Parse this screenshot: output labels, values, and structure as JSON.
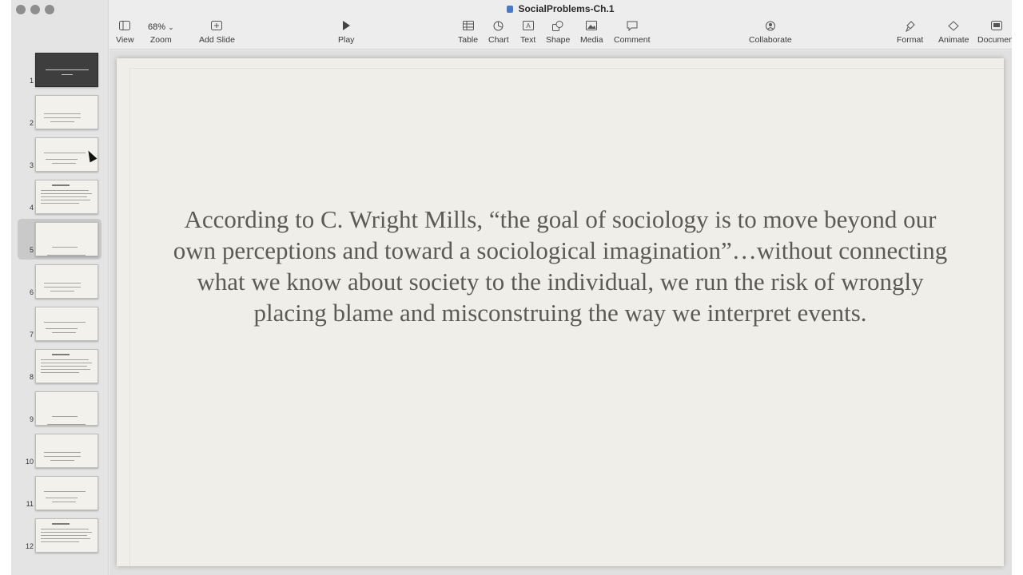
{
  "window": {
    "title": "SocialProblems-Ch.1"
  },
  "toolbar": {
    "view_label": "View",
    "zoom_value": "68%",
    "zoom_label": "Zoom",
    "add_slide_label": "Add Slide",
    "play_label": "Play",
    "table_label": "Table",
    "chart_label": "Chart",
    "text_label": "Text",
    "shape_label": "Shape",
    "media_label": "Media",
    "comment_label": "Comment",
    "collaborate_label": "Collaborate",
    "format_label": "Format",
    "animate_label": "Animate",
    "document_label": "Document"
  },
  "sidebar": {
    "slides": [
      {
        "num": "1",
        "dark": true,
        "selected": false
      },
      {
        "num": "2",
        "dark": false,
        "selected": false
      },
      {
        "num": "3",
        "dark": false,
        "selected": false
      },
      {
        "num": "4",
        "dark": false,
        "selected": false
      },
      {
        "num": "5",
        "dark": false,
        "selected": true
      },
      {
        "num": "6",
        "dark": false,
        "selected": false
      },
      {
        "num": "7",
        "dark": false,
        "selected": false
      },
      {
        "num": "8",
        "dark": false,
        "selected": false
      },
      {
        "num": "9",
        "dark": false,
        "selected": false
      },
      {
        "num": "10",
        "dark": false,
        "selected": false
      },
      {
        "num": "11",
        "dark": false,
        "selected": false
      },
      {
        "num": "12",
        "dark": false,
        "selected": false
      }
    ]
  },
  "slide": {
    "body_text": "According to C. Wright Mills, “the goal of sociology is to move beyond our own perceptions and toward a sociological imagination”…without connecting what we know about society to the individual, we run the risk of wrongly placing blame and misconstruing the way we interpret events."
  },
  "colors": {
    "slide_bg": "#efeee9",
    "slide_text": "#5c5a54",
    "sidebar_bg": "#e4e4e4",
    "toolbar_bg": "#ededed"
  }
}
